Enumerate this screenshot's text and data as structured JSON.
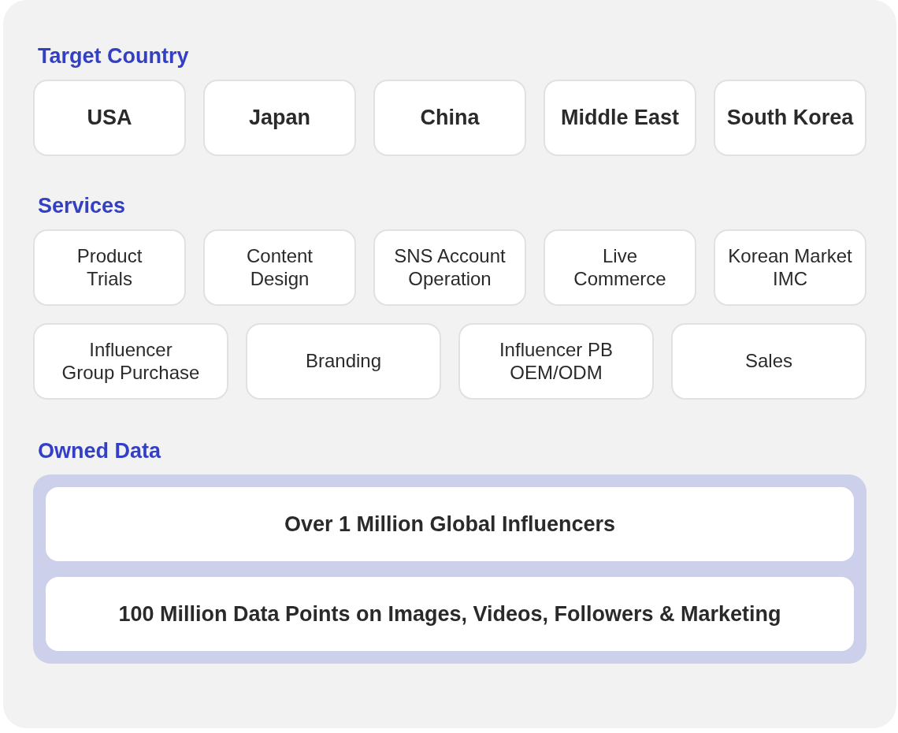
{
  "target_country": {
    "title": "Target Country",
    "items": [
      "USA",
      "Japan",
      "China",
      "Middle East",
      "South Korea"
    ]
  },
  "services": {
    "title": "Services",
    "rows": [
      {
        "items": [
          "Product\nTrials",
          "Content\nDesign",
          "SNS Account\nOperation",
          "Live\nCommerce",
          "Korean Market\nIMC"
        ]
      },
      {
        "items": [
          "Influencer\nGroup Purchase",
          "Branding",
          "Influencer PB\nOEM/ODM",
          "Sales"
        ]
      }
    ]
  },
  "owned_data": {
    "title": "Owned Data",
    "items": [
      "Over 1 Million Global Influencers",
      "100 Million Data Points on Images, Videos, Followers & Marketing"
    ]
  }
}
